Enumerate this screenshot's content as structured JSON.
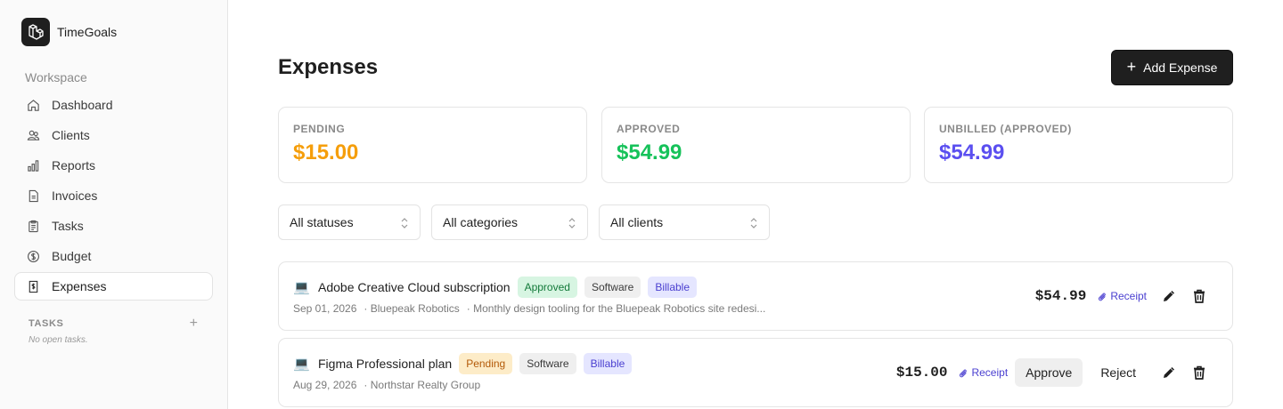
{
  "app": {
    "name": "TimeGoals"
  },
  "sidebar": {
    "section_label": "Workspace",
    "items": [
      {
        "label": "Dashboard",
        "icon": "home-icon",
        "active": false
      },
      {
        "label": "Clients",
        "icon": "users-icon",
        "active": false
      },
      {
        "label": "Reports",
        "icon": "bar-chart-icon",
        "active": false
      },
      {
        "label": "Invoices",
        "icon": "document-icon",
        "active": false
      },
      {
        "label": "Tasks",
        "icon": "clipboard-icon",
        "active": false
      },
      {
        "label": "Budget",
        "icon": "dollar-circle-icon",
        "active": false
      },
      {
        "label": "Expenses",
        "icon": "receipt-icon",
        "active": true
      }
    ],
    "tasks_title": "TASKS",
    "tasks_add": "+",
    "tasks_empty": "No open tasks."
  },
  "page": {
    "title": "Expenses",
    "add_button": "Add Expense"
  },
  "stats": [
    {
      "label": "PENDING",
      "value": "$15.00",
      "color": "#f59e0b"
    },
    {
      "label": "APPROVED",
      "value": "$54.99",
      "color": "#16c25a"
    },
    {
      "label": "UNBILLED (APPROVED)",
      "value": "$54.99",
      "color": "#5b4ff0"
    }
  ],
  "filters": {
    "status": "All statuses",
    "category": "All categories",
    "client": "All clients"
  },
  "expenses": [
    {
      "emoji": "💻",
      "title": "Adobe Creative Cloud subscription",
      "status": "Approved",
      "category": "Software",
      "billable": "Billable",
      "date": "Sep 01, 2026",
      "client": "· Bluepeak Robotics",
      "note": "· Monthly design tooling for the Bluepeak Robotics site redesi...",
      "amount": "$54.99",
      "receipt": "Receipt"
    },
    {
      "emoji": "💻",
      "title": "Figma Professional plan",
      "status": "Pending",
      "category": "Software",
      "billable": "Billable",
      "date": "Aug 29, 2026",
      "client": "· Northstar Realty Group",
      "amount": "$15.00",
      "receipt": "Receipt",
      "approve": "Approve",
      "reject": "Reject"
    }
  ]
}
